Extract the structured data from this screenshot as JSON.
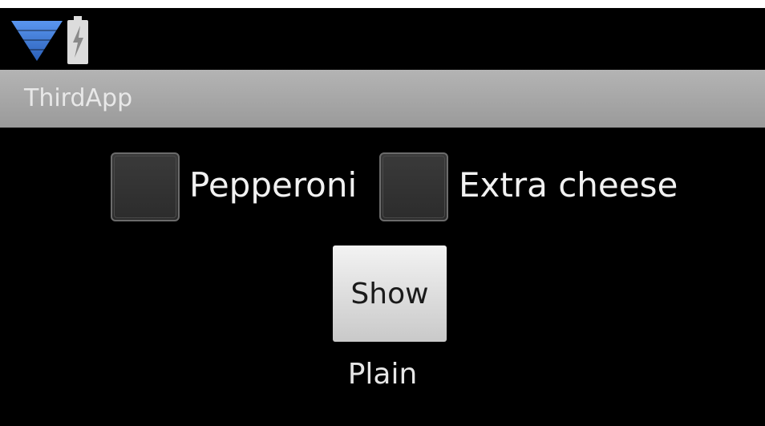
{
  "status_bar": {
    "icons": [
      "signal-icon",
      "battery-charging-icon"
    ]
  },
  "app_bar": {
    "title": "ThirdApp"
  },
  "options": {
    "pepperoni": {
      "label": "Pepperoni",
      "checked": false
    },
    "extra_cheese": {
      "label": "Extra cheese",
      "checked": false
    }
  },
  "show_button": {
    "label": "Show"
  },
  "result": {
    "text": "Plain"
  },
  "colors": {
    "background": "#000000",
    "title_bar": "#a6a6a6",
    "signal_blue": "#3b78d8",
    "text_light": "#f2f2f2"
  }
}
